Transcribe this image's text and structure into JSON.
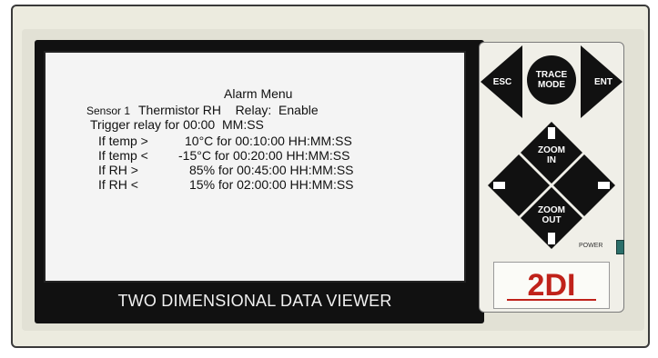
{
  "screen": {
    "title": "Alarm Menu",
    "sensor_label": "Sensor 1",
    "sensor_line": "Thermistor RH    Relay:  Enable",
    "trigger_line": "Trigger relay for 00:00  MM:SS",
    "alarms": [
      {
        "label": "If temp >",
        "value": "10°C for 00:10:00 HH:MM:SS"
      },
      {
        "label": "If temp <",
        "value": "-15°C for 00:20:00 HH:MM:SS"
      },
      {
        "label": "If RH >",
        "value": "85% for 00:45:00 HH:MM:SS"
      },
      {
        "label": "If RH <",
        "value": "15% for 02:00:00 HH:MM:SS"
      }
    ]
  },
  "caption": "TWO DIMENSIONAL DATA VIEWER",
  "keypad": {
    "esc": "ESC",
    "ent": "ENT",
    "trace_mode": [
      "TRACE",
      "MODE"
    ],
    "zoom_in": [
      "ZOOM",
      "IN"
    ],
    "zoom_out": [
      "ZOOM",
      "OUT"
    ],
    "power": "POWER"
  },
  "logo": {
    "text": "2DI"
  },
  "colors": {
    "keys": "#111111",
    "logo_red": "#c0221a",
    "led": "#2b6f6a"
  }
}
